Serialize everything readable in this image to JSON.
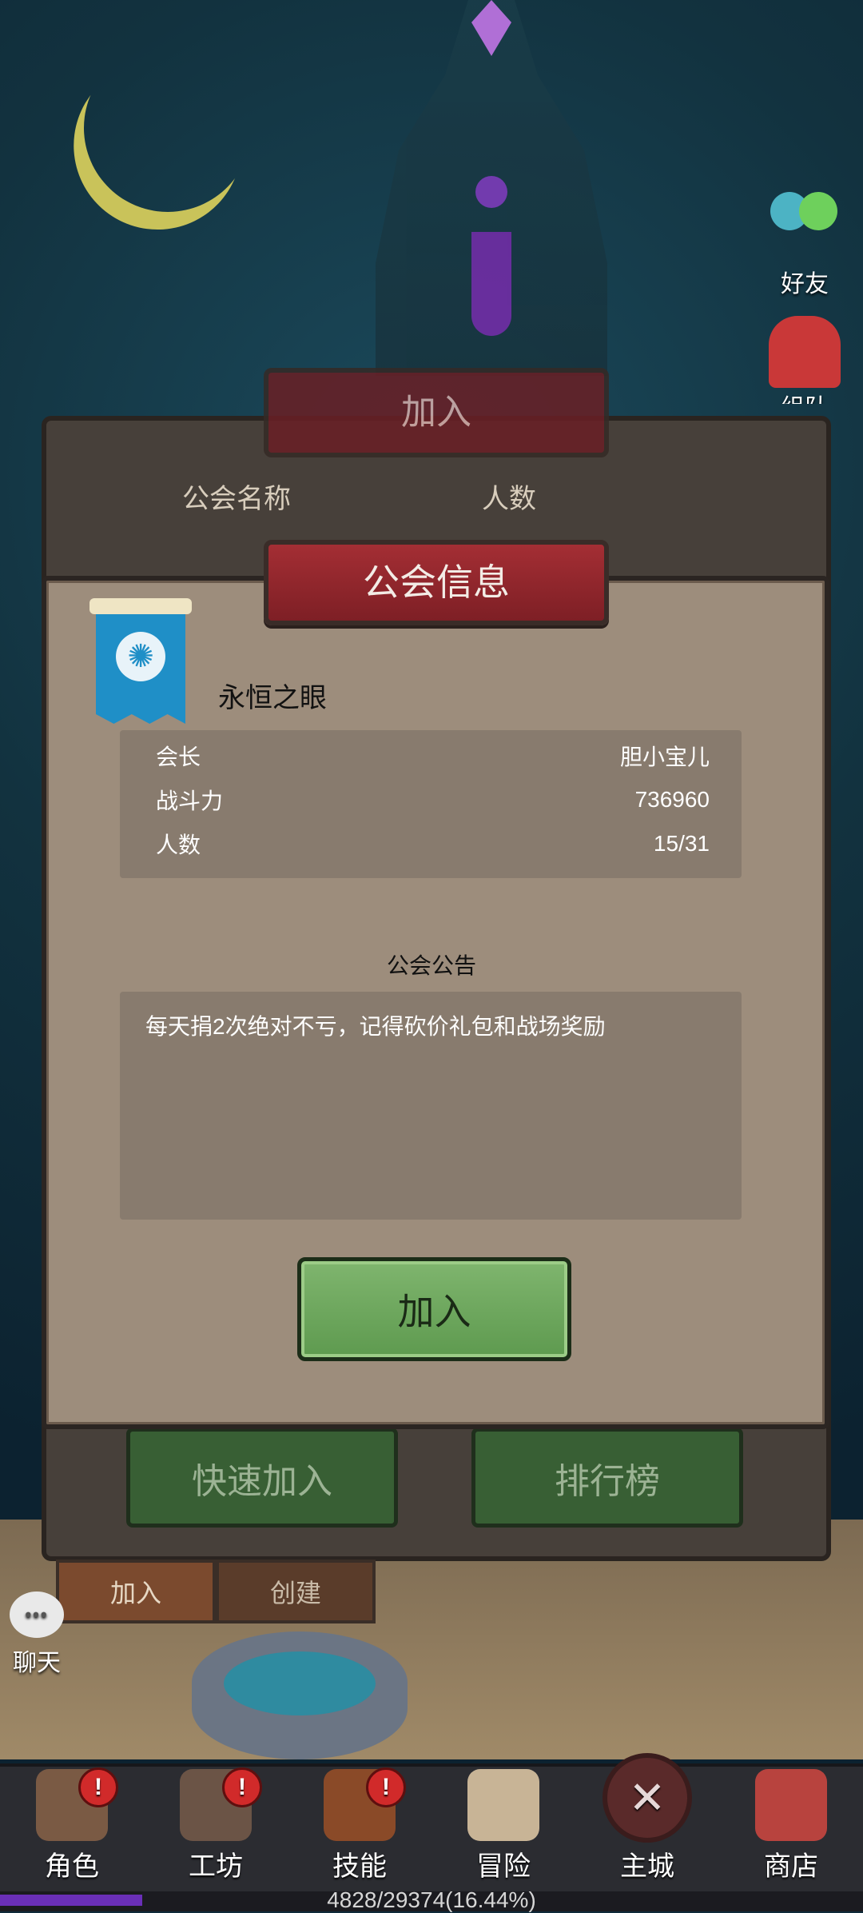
{
  "side": {
    "friends_label": "好友",
    "team_label": "组队"
  },
  "chat": {
    "label": "聊天",
    "bubble": "•••"
  },
  "background_panel": {
    "title": "加入",
    "col_name": "公会名称",
    "col_count": "人数",
    "tabs": [
      {
        "label": "加入"
      },
      {
        "label": "创建"
      }
    ],
    "quick_join_label": "快速加入",
    "leaderboard_label": "排行榜"
  },
  "modal": {
    "title": "公会信息",
    "guild_name": "永恒之眼",
    "info": {
      "leader_label": "会长",
      "leader_value": "胆小宝儿",
      "power_label": "战斗力",
      "power_value": "736960",
      "members_label": "人数",
      "members_value": "15/31"
    },
    "notice_title": "公会公告",
    "notice_text": "每天捐2次绝对不亏，记得砍价礼包和战场奖励",
    "join_label": "加入"
  },
  "nav": {
    "items": [
      {
        "label": "角色",
        "icon": "character-icon",
        "badge": "!"
      },
      {
        "label": "工坊",
        "icon": "workshop-icon",
        "badge": "!"
      },
      {
        "label": "技能",
        "icon": "skill-book-icon",
        "badge": "!"
      },
      {
        "label": "冒险",
        "icon": "adventure-map-icon"
      },
      {
        "label": "主城",
        "icon": "main-city-icon",
        "glyph": "✕"
      },
      {
        "label": "商店",
        "icon": "shop-icon"
      }
    ]
  },
  "exp": {
    "text": "4828/29374(16.44%)",
    "fraction": 0.1644
  },
  "colors": {
    "accent_red": "#a42e34",
    "green_button": "#6ea85f",
    "exp_purple": "#6a2fb8",
    "guild_flag_blue": "#1f8fc7"
  }
}
